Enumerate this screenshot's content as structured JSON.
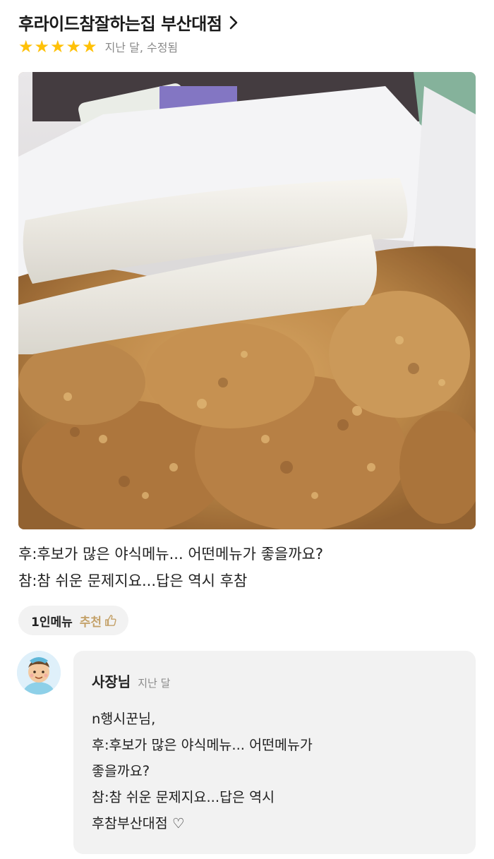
{
  "store": {
    "name": "후라이드참잘하는집 부산대점",
    "chevron_icon": "chevron-right-icon"
  },
  "rating": {
    "stars": 5,
    "max_stars": 5,
    "star_color": "#ffc107",
    "meta": "지난 달, 수정됨"
  },
  "review": {
    "photo_icon": "fried-chicken-photo",
    "lines": [
      "후:후보가 많은 야식메뉴... 어떤메뉴가 좋을까요?",
      "참:참 쉬운 문제지요...답은 역시 후참"
    ]
  },
  "menu_chip": {
    "menu": "1인메뉴",
    "recommend": "추천",
    "recommend_color": "#c4a26a",
    "icon": "thumbs-up-icon"
  },
  "owner_reply": {
    "name": "사장님",
    "time": "지난 달",
    "avatar_icon": "owner-avatar",
    "lines": [
      "n행시꾼님,",
      "후:후보가 많은 야식메뉴... 어떤메뉴가",
      "좋을까요?",
      "참:참 쉬운 문제지요...답은 역시",
      "후참부산대점 ♡"
    ]
  }
}
